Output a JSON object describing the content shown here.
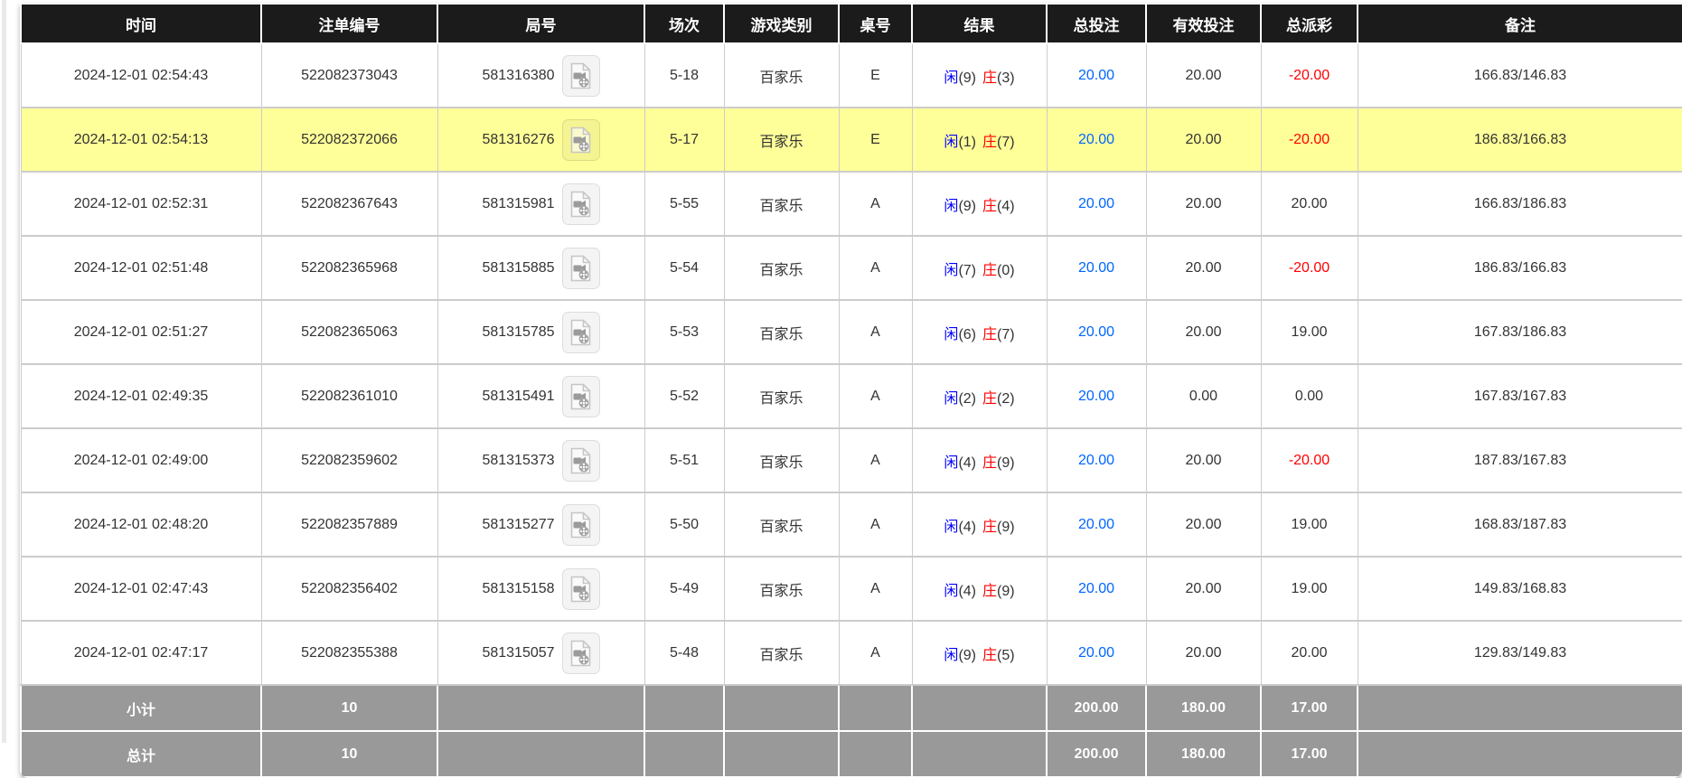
{
  "colors": {
    "header_bg": "#1b1b1b",
    "highlight_row_bg": "#ffff99",
    "footer_bg": "#999999",
    "bet_amount_blue": "#0066ff",
    "player_blue": "#0000ff",
    "banker_red": "#ff0000",
    "negative_red": "#ff0000",
    "cell_border": "#cccccc"
  },
  "table": {
    "columns": [
      {
        "key": "time",
        "label": "时间"
      },
      {
        "key": "bet_id",
        "label": "注单编号"
      },
      {
        "key": "round_id",
        "label": "局号"
      },
      {
        "key": "session",
        "label": "场次"
      },
      {
        "key": "game",
        "label": "游戏类别"
      },
      {
        "key": "table_no",
        "label": "桌号"
      },
      {
        "key": "result",
        "label": "结果"
      },
      {
        "key": "total_bet",
        "label": "总投注"
      },
      {
        "key": "valid_bet",
        "label": "有效投注"
      },
      {
        "key": "payout",
        "label": "总派彩"
      },
      {
        "key": "remark",
        "label": "备注"
      }
    ],
    "result_labels": {
      "player": "闲",
      "banker": "庄"
    },
    "video_icon_name": "video-file-icon",
    "rows": [
      {
        "time": "2024-12-01 02:54:43",
        "bet_id": "522082373043",
        "round_id": "581316380",
        "session": "5-18",
        "game": "百家乐",
        "table_no": "E",
        "player_score": "9",
        "banker_score": "3",
        "total_bet": "20.00",
        "valid_bet": "20.00",
        "payout": "-20.00",
        "remark": "166.83/146.83",
        "highlighted": false
      },
      {
        "time": "2024-12-01 02:54:13",
        "bet_id": "522082372066",
        "round_id": "581316276",
        "session": "5-17",
        "game": "百家乐",
        "table_no": "E",
        "player_score": "1",
        "banker_score": "7",
        "total_bet": "20.00",
        "valid_bet": "20.00",
        "payout": "-20.00",
        "remark": "186.83/166.83",
        "highlighted": true
      },
      {
        "time": "2024-12-01 02:52:31",
        "bet_id": "522082367643",
        "round_id": "581315981",
        "session": "5-55",
        "game": "百家乐",
        "table_no": "A",
        "player_score": "9",
        "banker_score": "4",
        "total_bet": "20.00",
        "valid_bet": "20.00",
        "payout": "20.00",
        "remark": "166.83/186.83",
        "highlighted": false
      },
      {
        "time": "2024-12-01 02:51:48",
        "bet_id": "522082365968",
        "round_id": "581315885",
        "session": "5-54",
        "game": "百家乐",
        "table_no": "A",
        "player_score": "7",
        "banker_score": "0",
        "total_bet": "20.00",
        "valid_bet": "20.00",
        "payout": "-20.00",
        "remark": "186.83/166.83",
        "highlighted": false
      },
      {
        "time": "2024-12-01 02:51:27",
        "bet_id": "522082365063",
        "round_id": "581315785",
        "session": "5-53",
        "game": "百家乐",
        "table_no": "A",
        "player_score": "6",
        "banker_score": "7",
        "total_bet": "20.00",
        "valid_bet": "20.00",
        "payout": "19.00",
        "remark": "167.83/186.83",
        "highlighted": false
      },
      {
        "time": "2024-12-01 02:49:35",
        "bet_id": "522082361010",
        "round_id": "581315491",
        "session": "5-52",
        "game": "百家乐",
        "table_no": "A",
        "player_score": "2",
        "banker_score": "2",
        "total_bet": "20.00",
        "valid_bet": "0.00",
        "payout": "0.00",
        "remark": "167.83/167.83",
        "highlighted": false
      },
      {
        "time": "2024-12-01 02:49:00",
        "bet_id": "522082359602",
        "round_id": "581315373",
        "session": "5-51",
        "game": "百家乐",
        "table_no": "A",
        "player_score": "4",
        "banker_score": "9",
        "total_bet": "20.00",
        "valid_bet": "20.00",
        "payout": "-20.00",
        "remark": "187.83/167.83",
        "highlighted": false
      },
      {
        "time": "2024-12-01 02:48:20",
        "bet_id": "522082357889",
        "round_id": "581315277",
        "session": "5-50",
        "game": "百家乐",
        "table_no": "A",
        "player_score": "4",
        "banker_score": "9",
        "total_bet": "20.00",
        "valid_bet": "20.00",
        "payout": "19.00",
        "remark": "168.83/187.83",
        "highlighted": false
      },
      {
        "time": "2024-12-01 02:47:43",
        "bet_id": "522082356402",
        "round_id": "581315158",
        "session": "5-49",
        "game": "百家乐",
        "table_no": "A",
        "player_score": "4",
        "banker_score": "9",
        "total_bet": "20.00",
        "valid_bet": "20.00",
        "payout": "19.00",
        "remark": "149.83/168.83",
        "highlighted": false
      },
      {
        "time": "2024-12-01 02:47:17",
        "bet_id": "522082355388",
        "round_id": "581315057",
        "session": "5-48",
        "game": "百家乐",
        "table_no": "A",
        "player_score": "9",
        "banker_score": "5",
        "total_bet": "20.00",
        "valid_bet": "20.00",
        "payout": "20.00",
        "remark": "129.83/149.83",
        "highlighted": false
      }
    ],
    "subtotal": {
      "label": "小计",
      "count": "10",
      "total_bet": "200.00",
      "valid_bet": "180.00",
      "payout": "17.00"
    },
    "total": {
      "label": "总计",
      "count": "10",
      "total_bet": "200.00",
      "valid_bet": "180.00",
      "payout": "17.00"
    }
  }
}
